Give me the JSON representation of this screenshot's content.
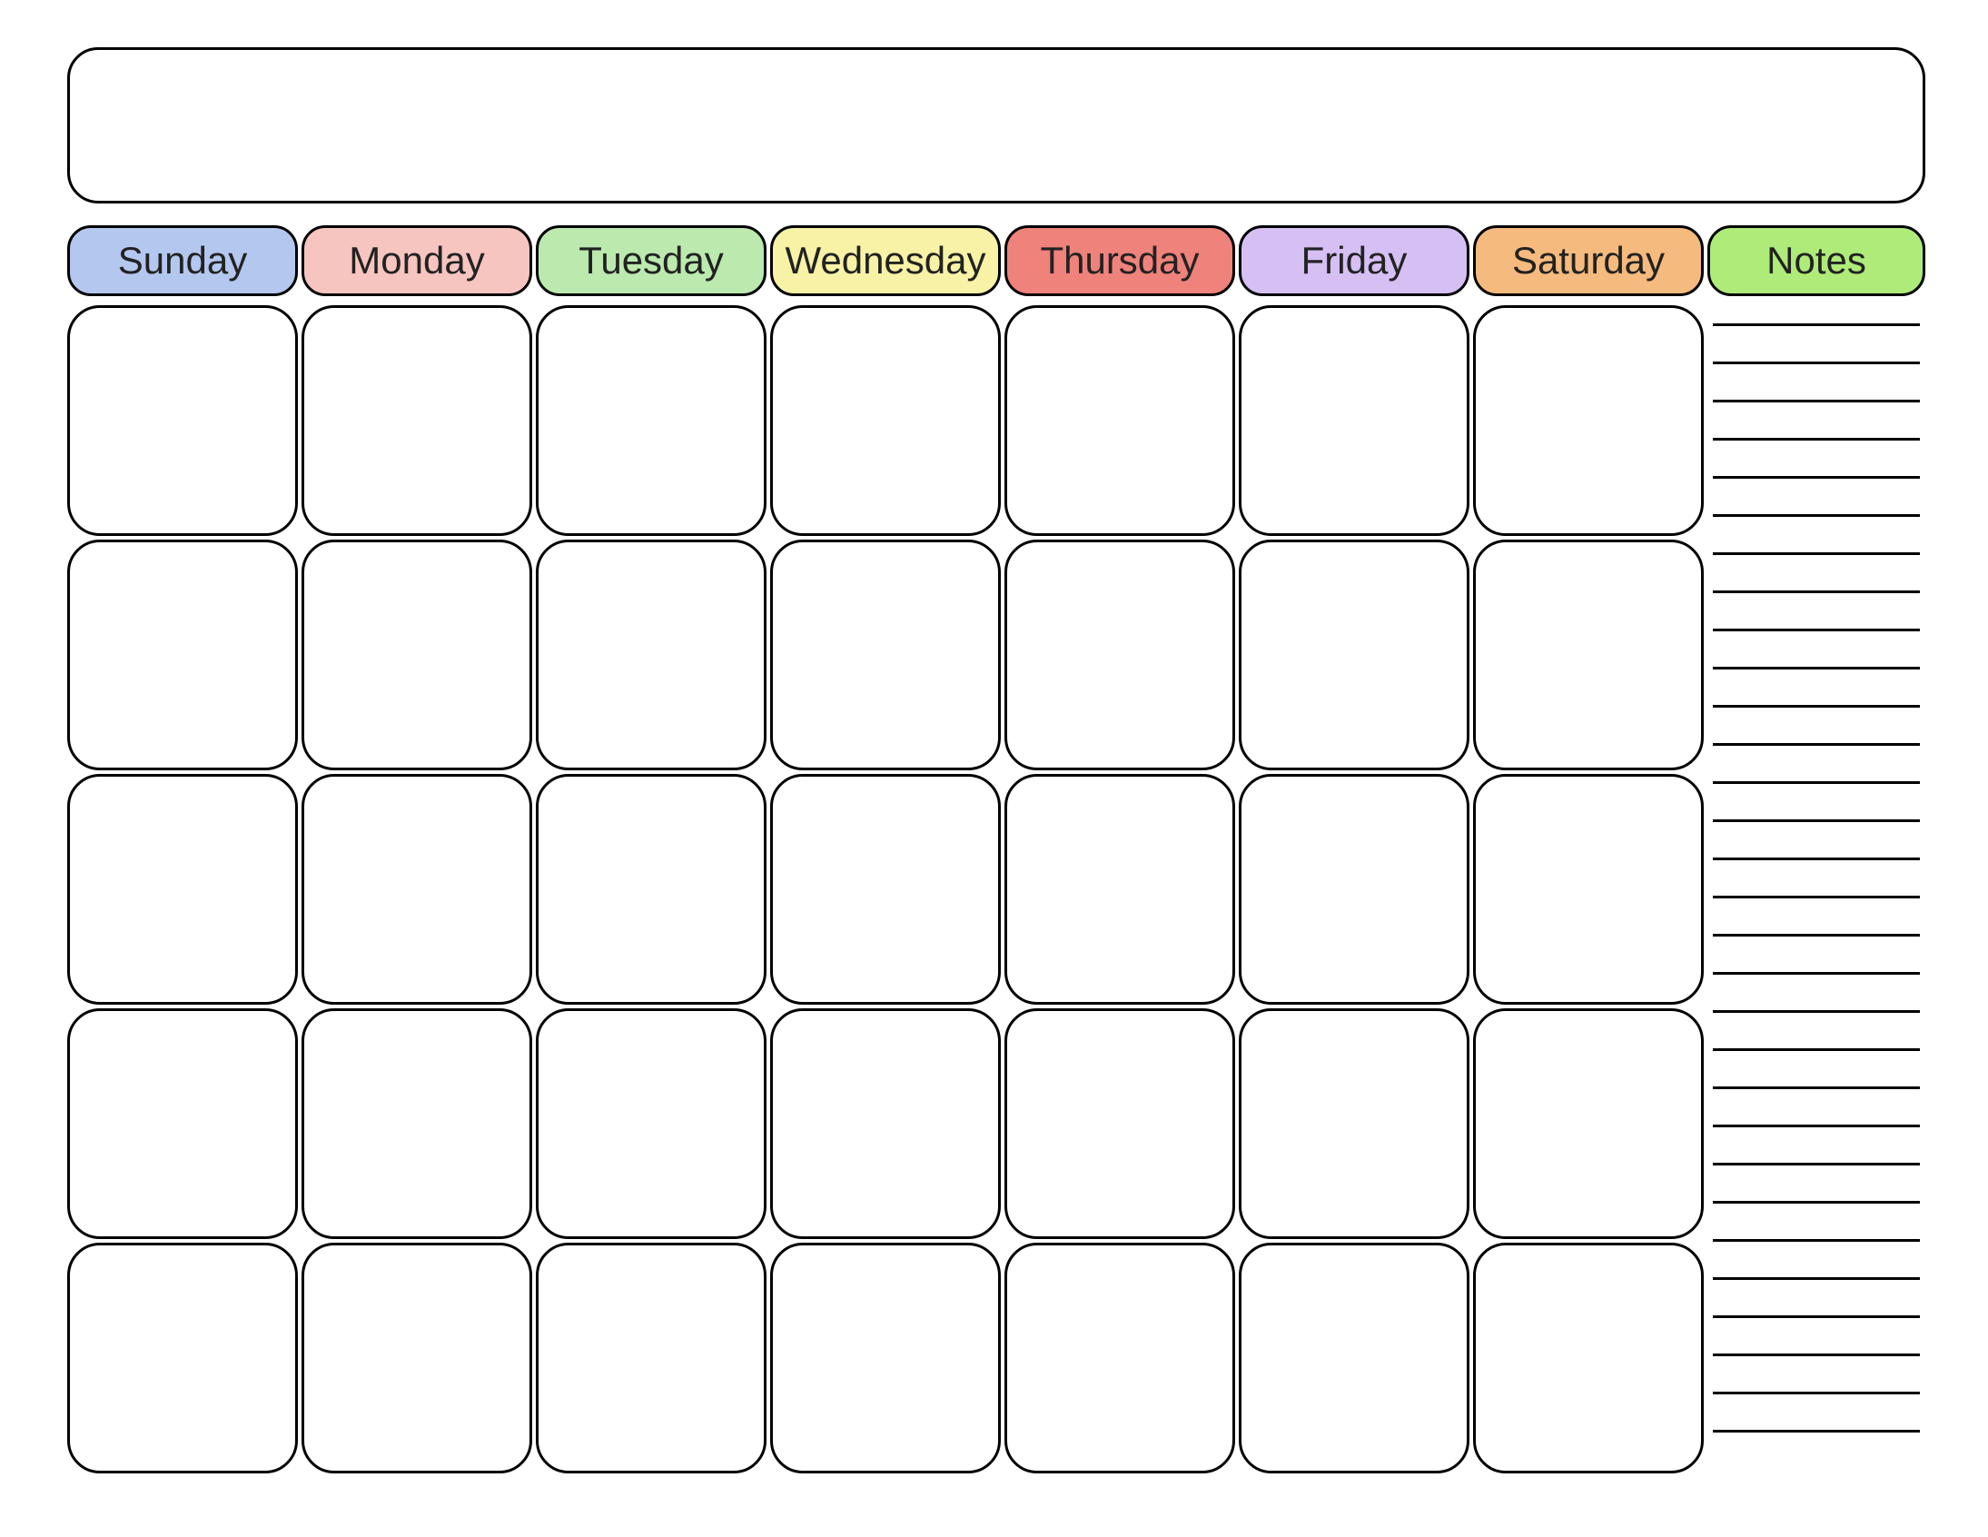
{
  "calendar": {
    "title": "",
    "days": [
      {
        "label": "Sunday",
        "color": "#b3c7ef"
      },
      {
        "label": "Monday",
        "color": "#f7c5bf"
      },
      {
        "label": "Tuesday",
        "color": "#bbe9ae"
      },
      {
        "label": "Wednesday",
        "color": "#f7f2a6"
      },
      {
        "label": "Thursday",
        "color": "#ef827b"
      },
      {
        "label": "Friday",
        "color": "#d5bff3"
      },
      {
        "label": "Saturday",
        "color": "#f5ba7d"
      }
    ],
    "notes": {
      "label": "Notes",
      "color": "#aeeb79",
      "line_count": 30
    },
    "rows": 5,
    "cols": 7
  }
}
